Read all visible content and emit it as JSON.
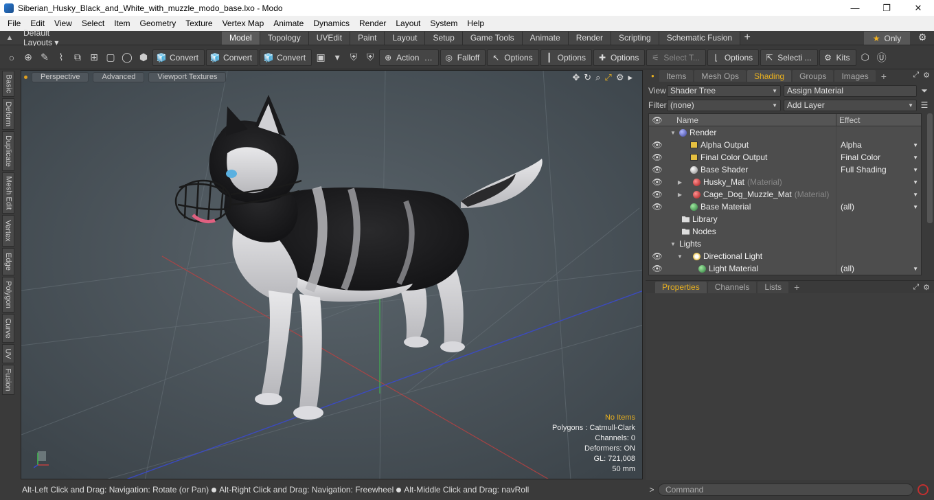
{
  "window": {
    "title": "Siberian_Husky_Black_and_White_with_muzzle_modo_base.lxo - Modo",
    "minimize": "—",
    "maximize": "❐",
    "close": "✕"
  },
  "menu": [
    "File",
    "Edit",
    "View",
    "Select",
    "Item",
    "Geometry",
    "Texture",
    "Vertex Map",
    "Animate",
    "Dynamics",
    "Render",
    "Layout",
    "System",
    "Help"
  ],
  "layoutbar": {
    "layouts_label": "Default Layouts ▾",
    "tabs": [
      "Model",
      "Topology",
      "UVEdit",
      "Paint",
      "Layout",
      "Setup",
      "Game Tools",
      "Animate",
      "Render",
      "Scripting",
      "Schematic Fusion"
    ],
    "active_tab": "Model",
    "only_label": "Only"
  },
  "toolbar": {
    "convert1": "Convert",
    "convert2": "Convert",
    "convert3": "Convert",
    "action": "Action",
    "falloff": "Falloff",
    "options1": "Options",
    "options2": "Options",
    "options3": "Options",
    "select_t": "Select T...",
    "options4": "Options",
    "selecti": "Selecti ...",
    "kits": "Kits"
  },
  "left_tabs": [
    "Basic",
    "Deform",
    "Duplicate",
    "Mesh Edit",
    "Vertex",
    "Edge",
    "Polygon",
    "Curve",
    "UV",
    "Fusion"
  ],
  "viewport": {
    "tabs": [
      "Perspective",
      "Advanced",
      "Viewport Textures"
    ],
    "info": {
      "no_items": "No Items",
      "polygons": "Polygons : Catmull-Clark",
      "channels": "Channels: 0",
      "deformers": "Deformers: ON",
      "gl": "GL: 721,008",
      "size": "50 mm"
    }
  },
  "statusbar": {
    "part1": "Alt-Left Click and Drag: Navigation: Rotate (or Pan)",
    "part2": "Alt-Right Click and Drag: Navigation: Freewheel",
    "part3": "Alt-Middle Click and Drag: navRoll"
  },
  "rightpanel": {
    "tabs": [
      "Items",
      "Mesh Ops",
      "Shading",
      "Groups",
      "Images"
    ],
    "active_tab": "Shading",
    "view_label": "View",
    "view_value": "Shader Tree",
    "assign_material": "Assign Material",
    "filter_label": "Filter",
    "filter_value": "(none)",
    "add_layer": "Add Layer",
    "tree": {
      "col_name": "Name",
      "col_effect": "Effect",
      "rows": [
        {
          "name": "Render",
          "sub": "",
          "effect": ""
        },
        {
          "name": "Alpha Output",
          "sub": "",
          "effect": "Alpha"
        },
        {
          "name": "Final Color Output",
          "sub": "",
          "effect": "Final Color"
        },
        {
          "name": "Base Shader",
          "sub": "",
          "effect": "Full Shading"
        },
        {
          "name": "Husky_Mat",
          "sub": "(Material)",
          "effect": ""
        },
        {
          "name": "Cage_Dog_Muzzle_Mat",
          "sub": "(Material)",
          "effect": ""
        },
        {
          "name": "Base Material",
          "sub": "",
          "effect": "(all)"
        },
        {
          "name": "Library",
          "sub": "",
          "effect": ""
        },
        {
          "name": "Nodes",
          "sub": "",
          "effect": ""
        },
        {
          "name": "Lights",
          "sub": "",
          "effect": ""
        },
        {
          "name": "Directional Light",
          "sub": "",
          "effect": ""
        },
        {
          "name": "Light Material",
          "sub": "",
          "effect": "(all)"
        }
      ]
    },
    "props_tabs": [
      "Properties",
      "Channels",
      "Lists"
    ],
    "props_active": "Properties",
    "command_placeholder": "Command"
  }
}
